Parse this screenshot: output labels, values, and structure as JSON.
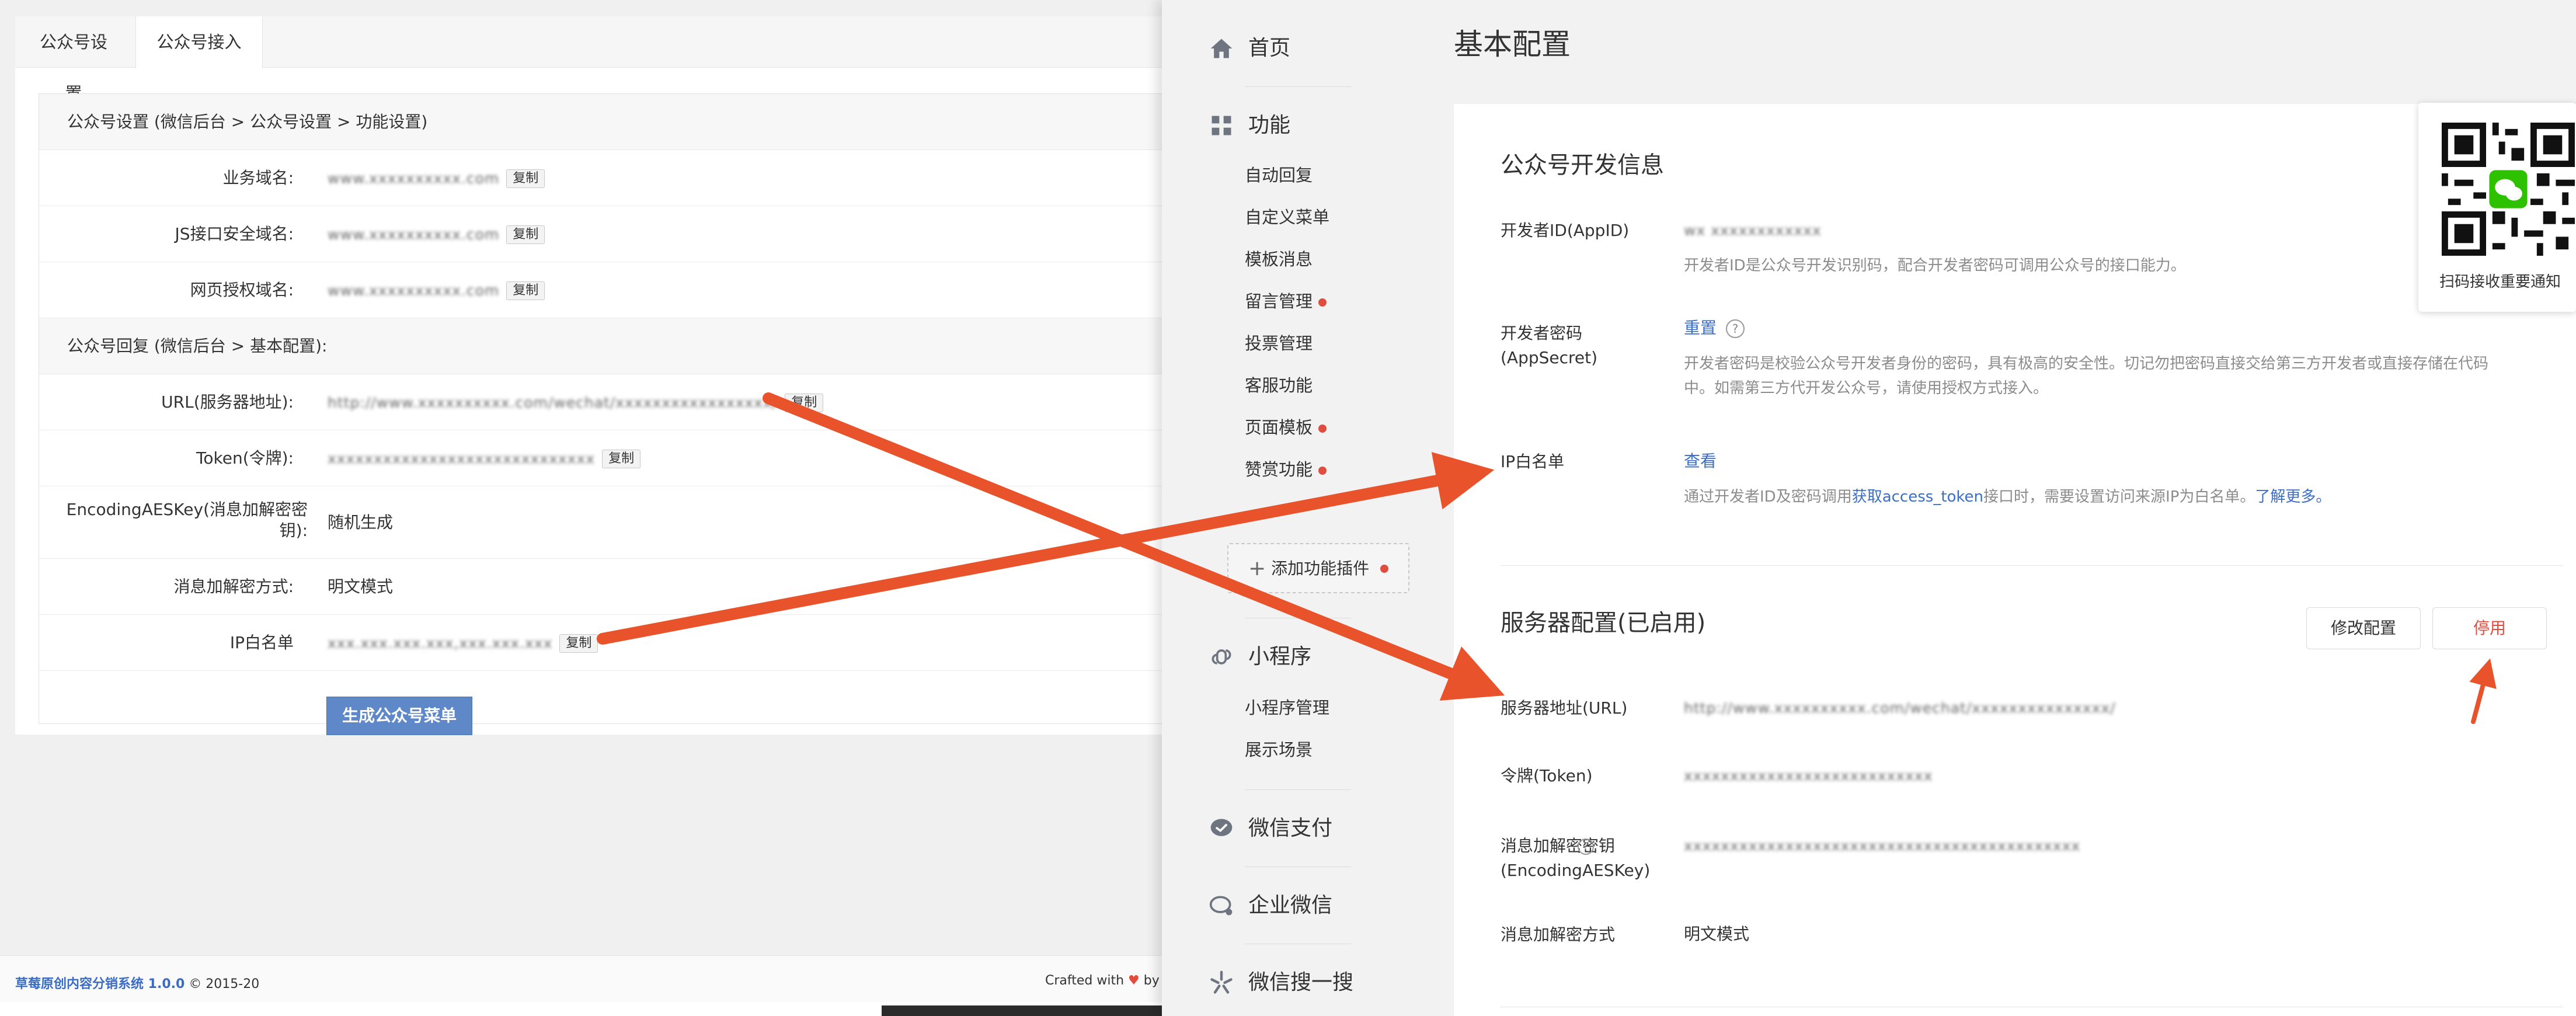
{
  "left": {
    "tabs": [
      "公众号设置",
      "公众号接入"
    ],
    "section1_title": "公众号设置 (微信后台 > 公众号设置 > 功能设置)",
    "section1_rows": [
      {
        "label": "业务域名:",
        "value": "www.xxxxxxxxxx.com",
        "copy": "复制"
      },
      {
        "label": "JS接口安全域名:",
        "value": "www.xxxxxxxxxx.com",
        "copy": "复制"
      },
      {
        "label": "网页授权域名:",
        "value": "www.xxxxxxxxxx.com",
        "copy": "复制"
      }
    ],
    "section2_title": "公众号回复 (微信后台 > 基本配置):",
    "section2_rows": [
      {
        "label": "URL(服务器地址):",
        "value": "http://www.xxxxxxxxxx.com/wechat/xxxxxxxxxxxxxxxxx/",
        "copy": "复制"
      },
      {
        "label": "Token(令牌):",
        "value": "xxxxxxxxxxxxxxxxxxxxxxxxxxxxx",
        "copy": "复制"
      }
    ],
    "aes_label": "EncodingAESKey(消息加解密密钥):",
    "aes_value": "随机生成",
    "mode_label": "消息加解密方式:",
    "mode_value": "明文模式",
    "ip_label": "IP白名单",
    "ip_value": "xxx.xxx.xxx.xxx,xxx.xxx.xxx",
    "ip_copy": "复制",
    "generate_button": "生成公众号菜单",
    "footer_brand": "草莓原创内容分销系统 1.0.0",
    "footer_copyright": "© 2015-20",
    "footer_crafted": "Crafted with",
    "footer_by": "by"
  },
  "sidebar": {
    "home": "首页",
    "functions": "功能",
    "function_items": [
      {
        "label": "自动回复",
        "dot": false
      },
      {
        "label": "自定义菜单",
        "dot": false
      },
      {
        "label": "模板消息",
        "dot": false
      },
      {
        "label": "留言管理",
        "dot": true
      },
      {
        "label": "投票管理",
        "dot": false
      },
      {
        "label": "客服功能",
        "dot": false
      },
      {
        "label": "页面模板",
        "dot": true
      },
      {
        "label": "赞赏功能",
        "dot": true
      }
    ],
    "add_plugin": "添加功能插件",
    "miniprogram": "小程序",
    "mini_items": [
      "小程序管理",
      "展示场景"
    ],
    "wxpay": "微信支付",
    "work_wechat": "企业微信",
    "search": "微信搜一搜"
  },
  "main": {
    "page_title": "基本配置",
    "dev_info_title": "公众号开发信息",
    "appid_label": "开发者ID(AppID)",
    "appid_value": "wx xxxxxxxxxxxx",
    "appid_desc": "开发者ID是公众号开发识别码，配合开发者密码可调用公众号的接口能力。",
    "secret_label": "开发者密码(AppSecret)",
    "secret_reset": "重置",
    "secret_desc": "开发者密码是校验公众号开发者身份的密码，具有极高的安全性。切记勿把密码直接交给第三方开发者或直接存储在代码中。如需第三方代开发公众号，请使用授权方式接入。",
    "ip_label": "IP白名单",
    "ip_view": "查看",
    "ip_desc_pre": "通过开发者ID及密码调用",
    "ip_desc_link": "获取access_token",
    "ip_desc_mid": "接口时，需要设置访问来源IP为白名单。",
    "ip_desc_more": "了解更多。",
    "server_title": "服务器配置(已启用)",
    "modify_button": "修改配置",
    "disable_button": "停用",
    "url_label": "服务器地址(URL)",
    "url_value": "http://www.xxxxxxxxxx.com/wechat/xxxxxxxxxxxxxxx/",
    "token_label": "令牌(Token)",
    "token_value": "xxxxxxxxxxxxxxxxxxxxxxxxxxx",
    "aes_label": "消息加解密密钥(EncodingAESKey)",
    "aes_value": "xxxxxxxxxxxxxxxxxxxxxxxxxxxxxxxxxxxxxxxxxxx",
    "mode_label": "消息加解密方式",
    "mode_value": "明文模式",
    "qr_label": "扫码接收重要通知"
  },
  "colors": {
    "arrow": "#e8532c",
    "link": "#3b6ec8",
    "primary_button": "#5f88c9",
    "dot": "#e04c3e"
  }
}
